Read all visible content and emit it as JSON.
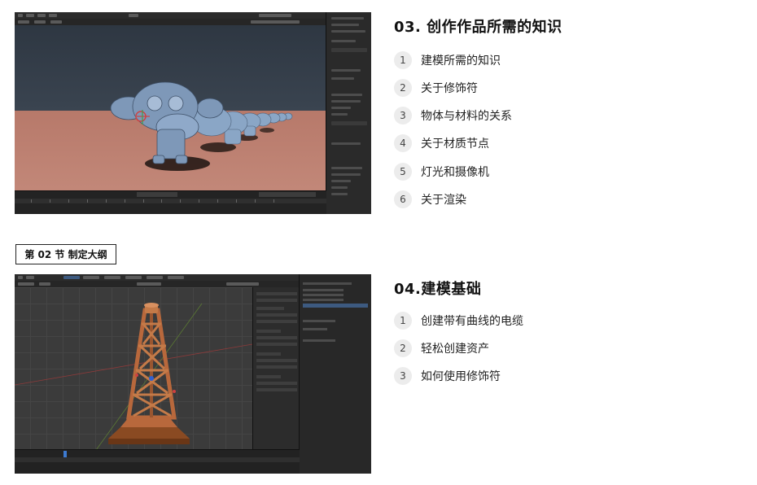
{
  "screenshot1": {
    "alt_name": "blender-suzanne-array",
    "timeline_ticks": [
      "0",
      "20",
      "40",
      "60",
      "80",
      "100",
      "120",
      "140",
      "160",
      "180",
      "200",
      "220",
      "240",
      "250"
    ]
  },
  "screenshot2": {
    "alt_name": "blender-tower-model"
  },
  "section1": {
    "title": "03. 创作作品所需的知识",
    "items": [
      {
        "num": "1",
        "label": "建模所需的知识"
      },
      {
        "num": "2",
        "label": "关于修饰符"
      },
      {
        "num": "3",
        "label": "物体与材料的关系"
      },
      {
        "num": "4",
        "label": "关于材质节点"
      },
      {
        "num": "5",
        "label": "灯光和摄像机"
      },
      {
        "num": "6",
        "label": "关于渲染"
      }
    ]
  },
  "chapter_tag": "第 02 节 制定大纲",
  "section2": {
    "title": "04.建模基础",
    "items": [
      {
        "num": "1",
        "label": "创建带有曲线的电缆"
      },
      {
        "num": "2",
        "label": "轻松创建资产"
      },
      {
        "num": "3",
        "label": "如何使用修饰符"
      }
    ]
  },
  "colors": {
    "num_bg": "#ececec",
    "floor": "#c48a7b",
    "model_copper": "#b8683c",
    "monkey": "#7e98b8"
  }
}
